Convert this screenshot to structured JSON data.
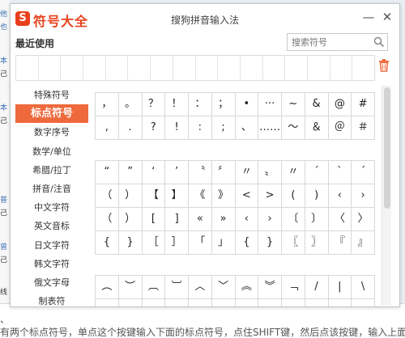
{
  "background": {
    "left_fragments": [
      "他",
      "也",
      "本",
      "己",
      "本",
      "己",
      "普",
      "己",
      "曾",
      "己",
      "线"
    ],
    "bottom_line1": "有两个标点符号，单点这个按键输入下面的标点符号，点住SHIFT键，然后点该按键，输入上面的",
    "bottom_line2": "、"
  },
  "dialog": {
    "app_name": "符号大全",
    "window_title": "搜狗拼音输入法",
    "logo_letter": "S",
    "minimize_label": "—",
    "close_label": "✕",
    "recent_label": "最近使用",
    "search_placeholder": "搜索符号",
    "recent_slots": 16,
    "accent_color": "#ee6a3c"
  },
  "sidebar": {
    "items": [
      {
        "label": "特殊符号",
        "active": false
      },
      {
        "label": "标点符号",
        "active": true
      },
      {
        "label": "数字序号",
        "active": false
      },
      {
        "label": "数学/单位",
        "active": false
      },
      {
        "label": "希腊/拉丁",
        "active": false
      },
      {
        "label": "拼音/注音",
        "active": false
      },
      {
        "label": "中文字符",
        "active": false
      },
      {
        "label": "英文音标",
        "active": false
      },
      {
        "label": "日文字符",
        "active": false
      },
      {
        "label": "韩文字符",
        "active": false
      },
      {
        "label": "俄文字母",
        "active": false
      },
      {
        "label": "制表符",
        "active": false
      }
    ]
  },
  "symbols": {
    "block1": [
      [
        "，",
        "。",
        "？",
        "！",
        "：",
        "；",
        "•",
        "···",
        "~",
        "&",
        "@",
        "#"
      ],
      [
        ",",
        ".",
        "?",
        "!",
        ":",
        ";",
        "、",
        "……",
        "～",
        "＆",
        "＠",
        "＃"
      ]
    ],
    "block2": [
      [
        "“",
        "”",
        "‘",
        "’",
        "〝",
        "〞",
        "〃",
        "〟",
        "〃",
        "ˊ",
        "ˋ",
        "ˊ"
      ],
      [
        "（",
        "）",
        "【",
        "】",
        "《",
        "》",
        "<",
        ">",
        "(",
        ")",
        "‹",
        "›"
      ],
      [
        "（",
        "）",
        "[",
        "]",
        "«",
        "»",
        "‹",
        "›",
        "〔",
        "〕",
        "〈",
        "〉"
      ],
      [
        "{",
        "}",
        "［",
        "］",
        "「",
        "」",
        "{",
        "}",
        "〖",
        "〗",
        "『",
        "』"
      ]
    ],
    "block3": [
      [
        "︵",
        "︶",
        "︹",
        "︺",
        "︿",
        "﹀",
        "︽",
        "︾",
        "﹁",
        "/",
        "|",
        "\\"
      ],
      [
        "",
        "",
        "",
        "",
        "",
        "",
        "",
        "",
        "",
        "",
        "",
        ""
      ]
    ]
  }
}
